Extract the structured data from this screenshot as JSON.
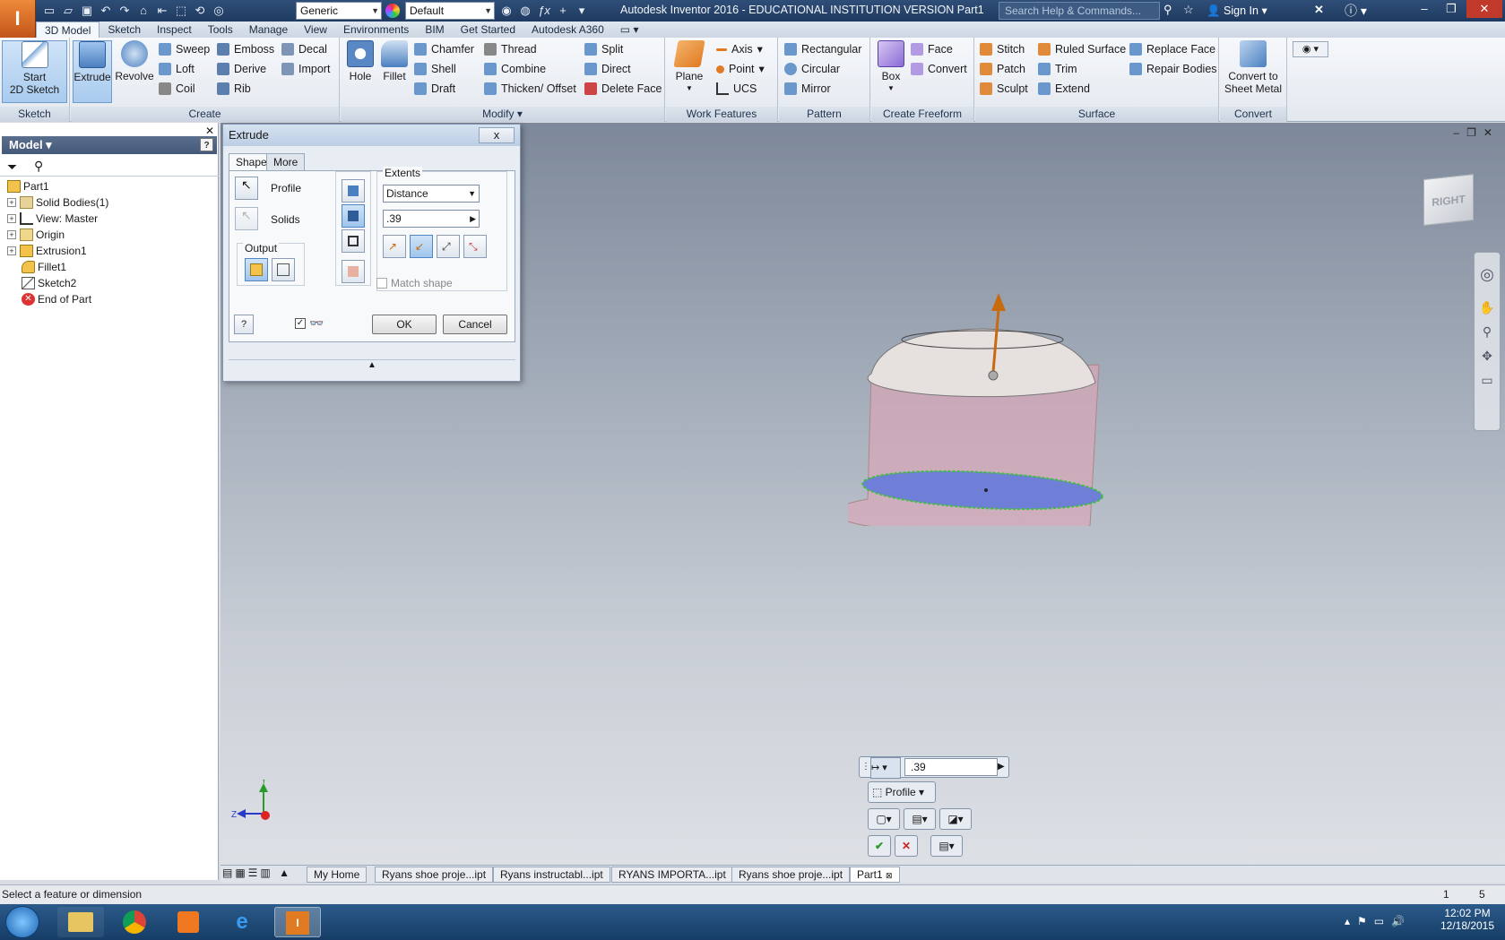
{
  "titlebar": {
    "app_button": "I",
    "material_combo": "Generic",
    "appearance_combo": "Default",
    "title": "Autodesk Inventor 2016 - EDUCATIONAL INSTITUTION VERSION    Part1",
    "search_placeholder": "Search Help & Commands...",
    "sign_in": "Sign In"
  },
  "menu_tabs": [
    "3D Model",
    "Sketch",
    "Inspect",
    "Tools",
    "Manage",
    "View",
    "Environments",
    "BIM",
    "Get Started",
    "Autodesk A360"
  ],
  "ribbon": {
    "sketch": {
      "title": "Sketch",
      "start_sketch_line1": "Start",
      "start_sketch_line2": "2D Sketch"
    },
    "create": {
      "title": "Create",
      "extrude": "Extrude",
      "revolve": "Revolve",
      "sweep": "Sweep",
      "loft": "Loft",
      "coil": "Coil",
      "emboss": "Emboss",
      "derive": "Derive",
      "rib": "Rib",
      "decal": "Decal",
      "import": "Import"
    },
    "modify": {
      "title": "Modify",
      "hole": "Hole",
      "fillet": "Fillet",
      "chamfer": "Chamfer",
      "shell": "Shell",
      "draft": "Draft",
      "thread": "Thread",
      "combine": "Combine",
      "thicken": "Thicken/ Offset",
      "split": "Split",
      "direct": "Direct",
      "delete_face": "Delete Face"
    },
    "work": {
      "title": "Work Features",
      "plane": "Plane",
      "axis": "Axis",
      "point": "Point",
      "ucs": "UCS"
    },
    "pattern": {
      "title": "Pattern",
      "rectangular": "Rectangular",
      "circular": "Circular",
      "mirror": "Mirror"
    },
    "freeform": {
      "title": "Create Freeform",
      "box": "Box",
      "face": "Face",
      "convert": "Convert"
    },
    "surface": {
      "title": "Surface",
      "stitch": "Stitch",
      "patch": "Patch",
      "sculpt": "Sculpt",
      "ruled": "Ruled Surface",
      "trim": "Trim",
      "extend": "Extend",
      "replace": "Replace Face",
      "repair": "Repair Bodies"
    },
    "convert": {
      "title": "Convert",
      "line1": "Convert to",
      "line2": "Sheet Metal"
    }
  },
  "browser": {
    "header": "Model",
    "tree": [
      {
        "label": "Part1",
        "expander": ""
      },
      {
        "label": "Solid Bodies(1)",
        "expander": "+"
      },
      {
        "label": "View: Master",
        "expander": "+"
      },
      {
        "label": "Origin",
        "expander": "+"
      },
      {
        "label": "Extrusion1",
        "expander": "+"
      },
      {
        "label": "Fillet1",
        "expander": ""
      },
      {
        "label": "Sketch2",
        "expander": ""
      },
      {
        "label": "End of Part",
        "expander": ""
      }
    ]
  },
  "dialog": {
    "title": "Extrude",
    "close": "x",
    "tab_shape": "Shape",
    "tab_more": "More",
    "profile_label": "Profile",
    "solids_label": "Solids",
    "output_label": "Output",
    "extents_label": "Extents",
    "extents_value": "Distance",
    "distance_value": ".39",
    "match_shape": "Match shape",
    "ok": "OK",
    "cancel": "Cancel"
  },
  "minitoolbar": {
    "distance_value": ".39",
    "profile": "Profile"
  },
  "viewcube": "RIGHT",
  "triad": {
    "y": "Y",
    "z": "Z"
  },
  "doc_tabs": [
    {
      "label": "My Home",
      "active": false
    },
    {
      "label": "Ryans shoe proje...ipt",
      "active": false
    },
    {
      "label": "Ryans instructabl...ipt",
      "active": false
    },
    {
      "label": "RYANS IMPORTA...ipt",
      "active": false
    },
    {
      "label": "Ryans shoe proje...ipt",
      "active": false
    },
    {
      "label": "Part1",
      "active": true
    }
  ],
  "status": {
    "message": "Select a feature or dimension",
    "count1": "1",
    "count2": "5"
  },
  "taskbar": {
    "time": "12:02 PM",
    "date": "12/18/2015"
  },
  "colors": {
    "accent": "#4f86c6",
    "title_bg": "#1f3a60",
    "profile_fill": "#6f7fd8",
    "body_fill": "#d9a7b8"
  }
}
